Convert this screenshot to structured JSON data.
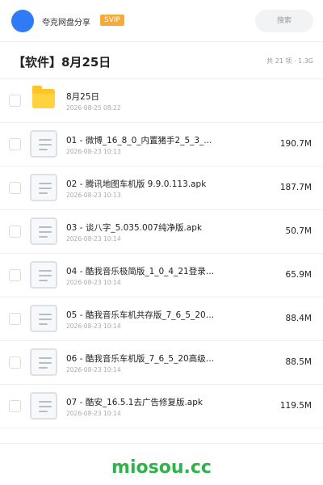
{
  "app": {
    "title": "夸克网盘分享",
    "badge": "SVIP",
    "search_placeholder": "搜索"
  },
  "folder": {
    "title": "【软件】8月25日",
    "meta": "共 21 项 · 1.3G"
  },
  "items": [
    {
      "type": "folder",
      "name": "8月25日",
      "date": "2026-08-25 08:22",
      "size": "",
      "icon": "folder-icon"
    },
    {
      "type": "file",
      "name": "01 - 微博_16_8_0_内置猪手2_5_3_...",
      "date": "2026-08-23 10:13",
      "size": "190.7M",
      "icon": "file-icon"
    },
    {
      "type": "file",
      "name": "02 - 腾讯地图车机版 9.9.0.113.apk",
      "date": "2026-08-23 10:13",
      "size": "187.7M",
      "icon": "file-icon"
    },
    {
      "type": "file",
      "name": "03 - 谈八字_5.035.007纯净版.apk",
      "date": "2026-08-23 10:14",
      "size": "50.7M",
      "icon": "file-icon"
    },
    {
      "type": "file",
      "name": "04 - 酷我音乐极简版_1_0_4_21登录高级...",
      "date": "2026-08-23 10:14",
      "size": "65.9M",
      "icon": "file-icon"
    },
    {
      "type": "file",
      "name": "05 - 酷我音乐车机共存版_7_6_5_20高级...",
      "date": "2026-08-23 10:14",
      "size": "88.4M",
      "icon": "file-icon"
    },
    {
      "type": "file",
      "name": "06 - 酷我音乐车机版_7_6_5_20高级版....",
      "date": "2026-08-23 10:14",
      "size": "88.5M",
      "icon": "file-icon"
    },
    {
      "type": "file",
      "name": "07 - 酷安_16.5.1去广告修复版.apk",
      "date": "2026-08-23 10:14",
      "size": "119.5M",
      "icon": "file-icon"
    }
  ],
  "watermark": "miosou.cc",
  "colors": {
    "accent": "#2f7bf6",
    "badge": "#f7a93a",
    "folder": "#ffc527",
    "watermark": "#2fb24a"
  }
}
